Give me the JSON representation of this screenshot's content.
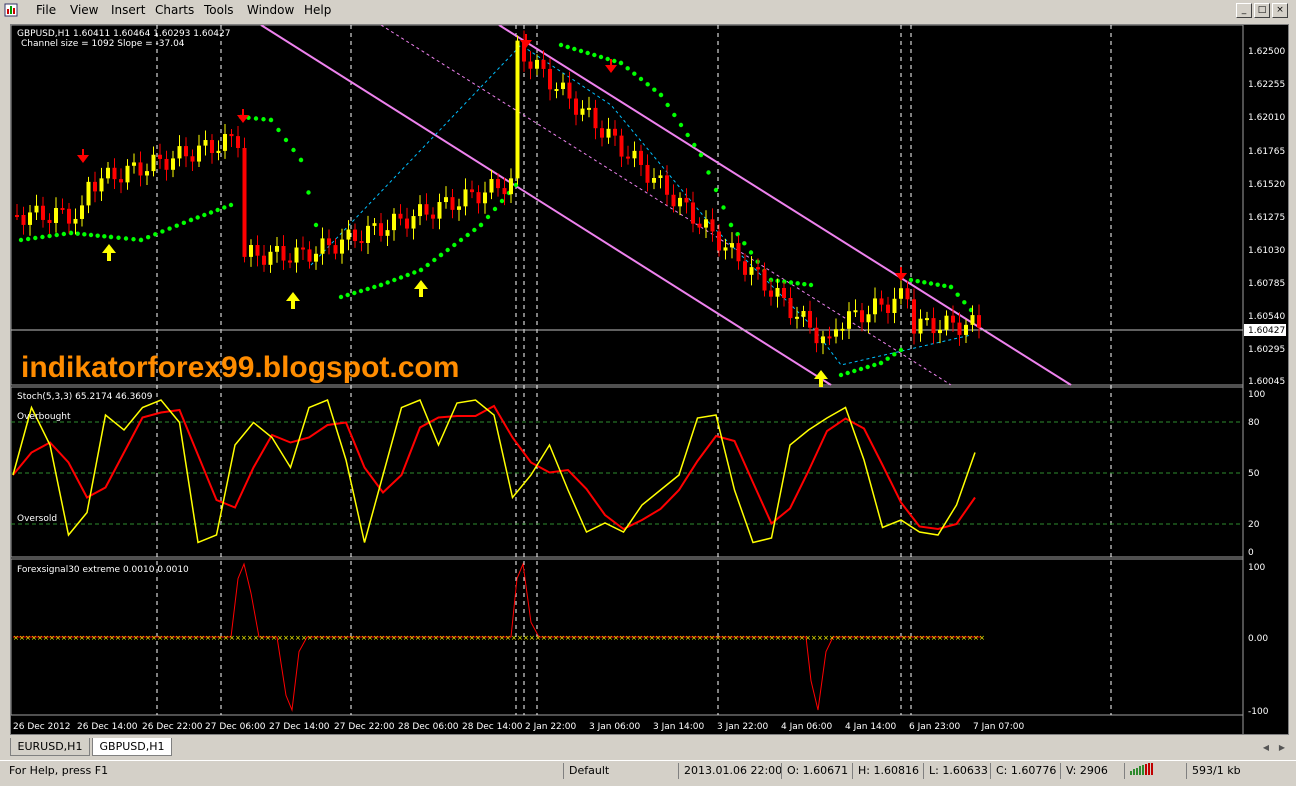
{
  "menu": {
    "items": [
      "File",
      "View",
      "Insert",
      "Charts",
      "Tools",
      "Window",
      "Help"
    ]
  },
  "window_controls": {
    "minimize": "_",
    "restore": "□",
    "close": "×"
  },
  "chart": {
    "symbol_line": "GBPUSD,H1  1.60411 1.60464 1.60293 1.60427",
    "channel_line": "Channel size = 1092 Slope = -37.04",
    "watermark": "indikatorforex99.blogspot.com",
    "current_price": "1.60427",
    "price_axis": [
      "1.62500",
      "1.62255",
      "1.62010",
      "1.61765",
      "1.61520",
      "1.61275",
      "1.61030",
      "1.60785",
      "1.60540",
      "1.60295",
      "1.60045"
    ],
    "stoch_label": "Stoch(5,3,3) 65.2174 46.3609",
    "stoch_overbought": "Overbought",
    "stoch_oversold": "Oversold",
    "stoch_axis": [
      "100",
      "80",
      "50",
      "20",
      "0"
    ],
    "fx_label": "Forexsignal30 extreme 0.0010 0.0010",
    "fx_axis": [
      "100",
      "0.00",
      "-100"
    ],
    "time_axis": [
      "26 Dec 2012",
      "26 Dec 14:00",
      "26 Dec 22:00",
      "27 Dec 06:00",
      "27 Dec 14:00",
      "27 Dec 22:00",
      "28 Dec 06:00",
      "28 Dec 14:00",
      "2 Jan 22:00",
      "3 Jan 06:00",
      "3 Jan 14:00",
      "3 Jan 22:00",
      "4 Jan 06:00",
      "4 Jan 14:00",
      "6 Jan 23:00",
      "7 Jan 07:00"
    ],
    "colors": {
      "bull": "#ffff00",
      "bear": "#ff0000",
      "dots": "#00ff00",
      "channel": "#ee82ee",
      "bg": "#000000",
      "grid": "#ffffff"
    }
  },
  "tabs": [
    "EURUSD,H1",
    "GBPUSD,H1"
  ],
  "active_tab": "GBPUSD,H1",
  "status": {
    "help": "For Help, press F1",
    "profile": "Default",
    "datetime": "2013.01.06 22:00",
    "open": "O: 1.60671",
    "high": "H: 1.60816",
    "low": "L: 1.60633",
    "close": "C: 1.60776",
    "volume": "V: 2906",
    "traffic": "593/1 kb"
  }
}
